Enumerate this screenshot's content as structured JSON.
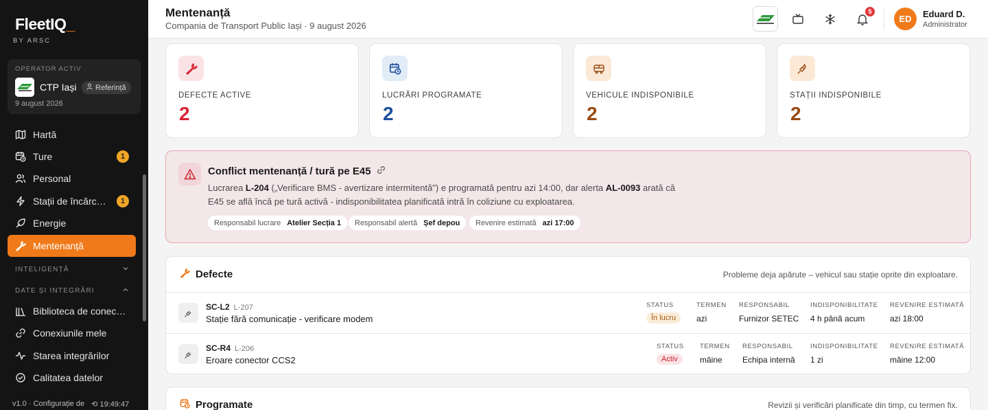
{
  "sidebar": {
    "logo": "FleetIQ",
    "logo_cursor": "_",
    "byline": "BY ARSC",
    "operator": {
      "label": "OPERATOR ACTIV",
      "name": "CTP Iași",
      "ref": "Referință",
      "date": "9 august 2026"
    },
    "items": [
      {
        "label": "Hartă",
        "icon": "map-icon"
      },
      {
        "label": "Ture",
        "icon": "calendar-clock-icon",
        "badge": "1"
      },
      {
        "label": "Personal",
        "icon": "people-icon"
      },
      {
        "label": "Stații de încărc…",
        "icon": "bolt-icon",
        "badge": "1"
      },
      {
        "label": "Energie",
        "icon": "leaf-icon"
      },
      {
        "label": "Mentenanță",
        "icon": "wrench-icon",
        "active": true
      }
    ],
    "sections": [
      {
        "label": "INTELIGENȚĂ",
        "chevron": "down"
      },
      {
        "label": "DATE ȘI INTEGRĂRI",
        "chevron": "up"
      }
    ],
    "data_items": [
      {
        "label": "Biblioteca de conec…",
        "icon": "library-icon"
      },
      {
        "label": "Conexiunile mele",
        "icon": "link-icon"
      },
      {
        "label": "Starea integrărilor",
        "icon": "pulse-icon"
      },
      {
        "label": "Calitatea datelor",
        "icon": "quality-icon"
      }
    ],
    "footer_version": "v1.0 · Configurație de",
    "footer_time": "19:49:47"
  },
  "header": {
    "title": "Mentenanță",
    "subtitle": "Compania de Transport Public Iași · 9 august 2026",
    "notifications": "5",
    "user": {
      "initials": "ED",
      "name": "Eduard D.",
      "role": "Administrator"
    }
  },
  "stats": [
    {
      "label": "DEFECTE ACTIVE",
      "value": "2",
      "icon": "wrench-icon",
      "color": "#d92332",
      "bg": "#fbe3e5"
    },
    {
      "label": "LUCRĂRI PROGRAMATE",
      "value": "2",
      "icon": "calendar-clock-icon",
      "color": "#1c4f9c",
      "bg": "#e1ecf7"
    },
    {
      "label": "VEHICULE INDISPONIBILE",
      "value": "2",
      "icon": "bus-icon",
      "color": "#9a4a12",
      "bg": "#fbe9d6"
    },
    {
      "label": "STAȚII INDISPONIBILE",
      "value": "2",
      "icon": "plug-icon",
      "color": "#9a4a12",
      "bg": "#fbe9d6"
    }
  ],
  "conflict": {
    "title": "Conflict mentenanță / tură pe E45",
    "text_1": "Lucrarea ",
    "work_id": "L-204",
    "text_2": " („Verificare BMS - avertizare intermitentă\") e programată pentru azi 14:00, dar alerta ",
    "alert_id": "AL-0093",
    "text_3": " arată că E45 se află încă pe tură activă - indisponibilitatea planificată intră în coliziune cu exploatarea.",
    "chips": [
      {
        "key": "Responsabil lucrare",
        "value": "Atelier Secția 1"
      },
      {
        "key": "Responsabil alertă",
        "value": "Șef depou"
      },
      {
        "key": "Revenire estimată",
        "value": "azi 17:00"
      }
    ]
  },
  "defects": {
    "title": "Defecte",
    "description": "Probleme deja apărute – vehicul sau stație oprite din exploatare.",
    "columns": {
      "status": "STATUS",
      "term": "TERMEN",
      "owner": "RESPONSABIL",
      "unavailability": "INDISPONIBILITATE",
      "eta": "REVENIRE ESTIMATĂ"
    },
    "rows": [
      {
        "code": "SC-L2",
        "ref": "L-207",
        "desc": "Stație fără comunicație - verificare modem",
        "status": "În lucru",
        "status_color": "#a65a12",
        "status_bg": "#fbecd8",
        "term": "azi",
        "owner": "Furnizor SETEC",
        "unavailability": "4 h până acum",
        "eta": "azi 18:00"
      },
      {
        "code": "SC-R4",
        "ref": "L-206",
        "desc": "Eroare conector CCS2",
        "status": "Activ",
        "status_color": "#c8202e",
        "status_bg": "#fbe3e5",
        "term": "mâine",
        "owner": "Echipa internă",
        "unavailability": "1 zi",
        "eta": "mâine 12:00"
      }
    ]
  },
  "scheduled": {
    "title": "Programate",
    "description": "Revizii și verificări planificate din timp, cu termen fix."
  }
}
